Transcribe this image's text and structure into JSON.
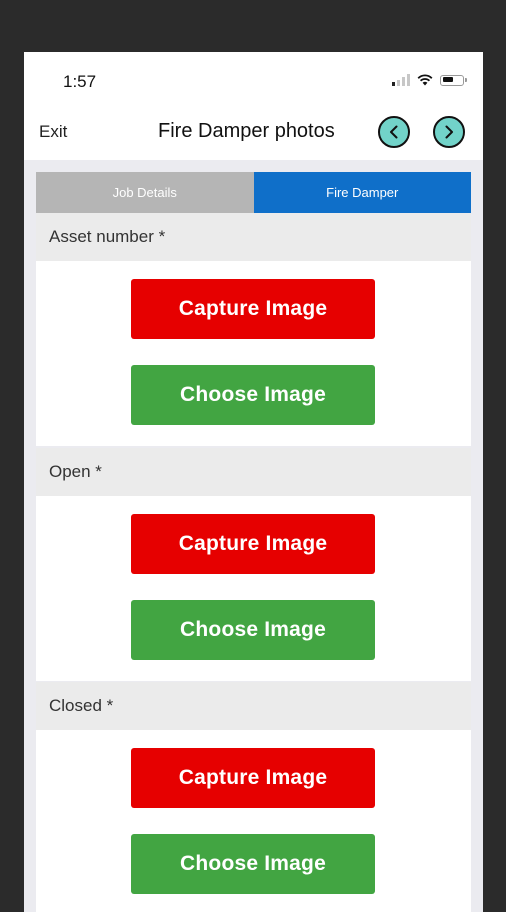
{
  "status_bar": {
    "time": "1:57"
  },
  "nav": {
    "exit_label": "Exit",
    "title": "Fire Damper photos",
    "prev_icon": "chevron-left-icon",
    "next_icon": "chevron-right-icon"
  },
  "tabs": [
    {
      "label": "Job Details",
      "active": false
    },
    {
      "label": "Fire Damper",
      "active": true
    }
  ],
  "sections": [
    {
      "label": "Asset number *",
      "capture_label": "Capture Image",
      "choose_label": "Choose Image"
    },
    {
      "label": "Open *",
      "capture_label": "Capture Image",
      "choose_label": "Choose Image"
    },
    {
      "label": "Closed *",
      "capture_label": "Capture Image",
      "choose_label": "Choose Image"
    }
  ],
  "colors": {
    "capture": "#e60000",
    "choose": "#42a542",
    "active_tab": "#0f6fc9",
    "inactive_tab": "#b5b5b5",
    "nav_button": "#72d3c9"
  }
}
